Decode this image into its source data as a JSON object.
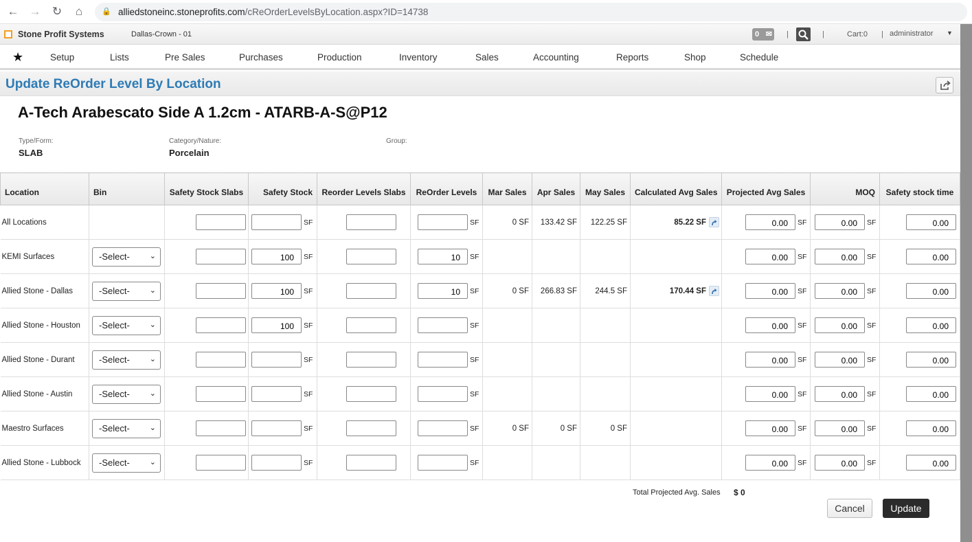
{
  "browser": {
    "url_host": "alliedstoneinc.stoneprofits.com",
    "url_path": "/cReOrderLevelsByLocation.aspx?ID=14738"
  },
  "header": {
    "app_name": "Stone Profit Systems",
    "company": "Dallas-Crown - 01",
    "message_count": "0",
    "cart": "Cart:0",
    "user": "administrator"
  },
  "nav": {
    "items": [
      "Setup",
      "Lists",
      "Pre Sales",
      "Purchases",
      "Production",
      "Inventory",
      "Sales",
      "Accounting",
      "Reports",
      "Shop",
      "Schedule"
    ]
  },
  "page": {
    "title": "Update ReOrder Level By Location",
    "product": "A-Tech Arabescato Side A 1.2cm - ATARB-A-S@P12",
    "type_label": "Type/Form:",
    "type_value": "SLAB",
    "category_label": "Category/Nature:",
    "category_value": "Porcelain",
    "group_label": "Group:",
    "group_value": ""
  },
  "table": {
    "columns": [
      "Location",
      "Bin",
      "Safety Stock Slabs",
      "Safety Stock",
      "Reorder Levels Slabs",
      "ReOrder Levels",
      "Mar Sales",
      "Apr Sales",
      "May Sales",
      "Calculated Avg Sales",
      "Projected Avg Sales",
      "MOQ",
      "Safety stock time"
    ],
    "unit": "SF",
    "select_placeholder": "-Select-",
    "rows": [
      {
        "location": "All Locations",
        "bin": "",
        "safety_slabs": "",
        "safety_stock": "",
        "reorder_slabs": "",
        "reorder_levels": "",
        "mar": "0 SF",
        "apr": "133.42 SF",
        "may": "122.25 SF",
        "calc": "85.22 SF",
        "projected": "0.00",
        "moq": "0.00",
        "safety_time": "0.00"
      },
      {
        "location": "KEMI Surfaces",
        "bin": "-Select-",
        "safety_slabs": "",
        "safety_stock": "100",
        "reorder_slabs": "",
        "reorder_levels": "10",
        "mar": "",
        "apr": "",
        "may": "",
        "calc": "",
        "projected": "0.00",
        "moq": "0.00",
        "safety_time": "0.00"
      },
      {
        "location": "Allied Stone - Dallas",
        "bin": "-Select-",
        "safety_slabs": "",
        "safety_stock": "100",
        "reorder_slabs": "",
        "reorder_levels": "10",
        "mar": "0 SF",
        "apr": "266.83 SF",
        "may": "244.5 SF",
        "calc": "170.44 SF",
        "projected": "0.00",
        "moq": "0.00",
        "safety_time": "0.00"
      },
      {
        "location": "Allied Stone - Houston",
        "bin": "-Select-",
        "safety_slabs": "",
        "safety_stock": "100",
        "reorder_slabs": "",
        "reorder_levels": "",
        "mar": "",
        "apr": "",
        "may": "",
        "calc": "",
        "projected": "0.00",
        "moq": "0.00",
        "safety_time": "0.00"
      },
      {
        "location": "Allied Stone - Durant",
        "bin": "-Select-",
        "safety_slabs": "",
        "safety_stock": "",
        "reorder_slabs": "",
        "reorder_levels": "",
        "mar": "",
        "apr": "",
        "may": "",
        "calc": "",
        "projected": "0.00",
        "moq": "0.00",
        "safety_time": "0.00"
      },
      {
        "location": "Allied Stone - Austin",
        "bin": "-Select-",
        "safety_slabs": "",
        "safety_stock": "",
        "reorder_slabs": "",
        "reorder_levels": "",
        "mar": "",
        "apr": "",
        "may": "",
        "calc": "",
        "projected": "0.00",
        "moq": "0.00",
        "safety_time": "0.00"
      },
      {
        "location": "Maestro Surfaces",
        "bin": "-Select-",
        "safety_slabs": "",
        "safety_stock": "",
        "reorder_slabs": "",
        "reorder_levels": "",
        "mar": "0 SF",
        "apr": "0 SF",
        "may": "0 SF",
        "calc": "",
        "projected": "0.00",
        "moq": "0.00",
        "safety_time": "0.00"
      },
      {
        "location": "Allied Stone - Lubbock",
        "bin": "-Select-",
        "safety_slabs": "",
        "safety_stock": "",
        "reorder_slabs": "",
        "reorder_levels": "",
        "mar": "",
        "apr": "",
        "may": "",
        "calc": "",
        "projected": "0.00",
        "moq": "0.00",
        "safety_time": "0.00"
      }
    ]
  },
  "footer": {
    "total_label": "Total Projected Avg. Sales",
    "total_value": "$ 0",
    "cancel_label": "Cancel",
    "update_label": "Update"
  }
}
